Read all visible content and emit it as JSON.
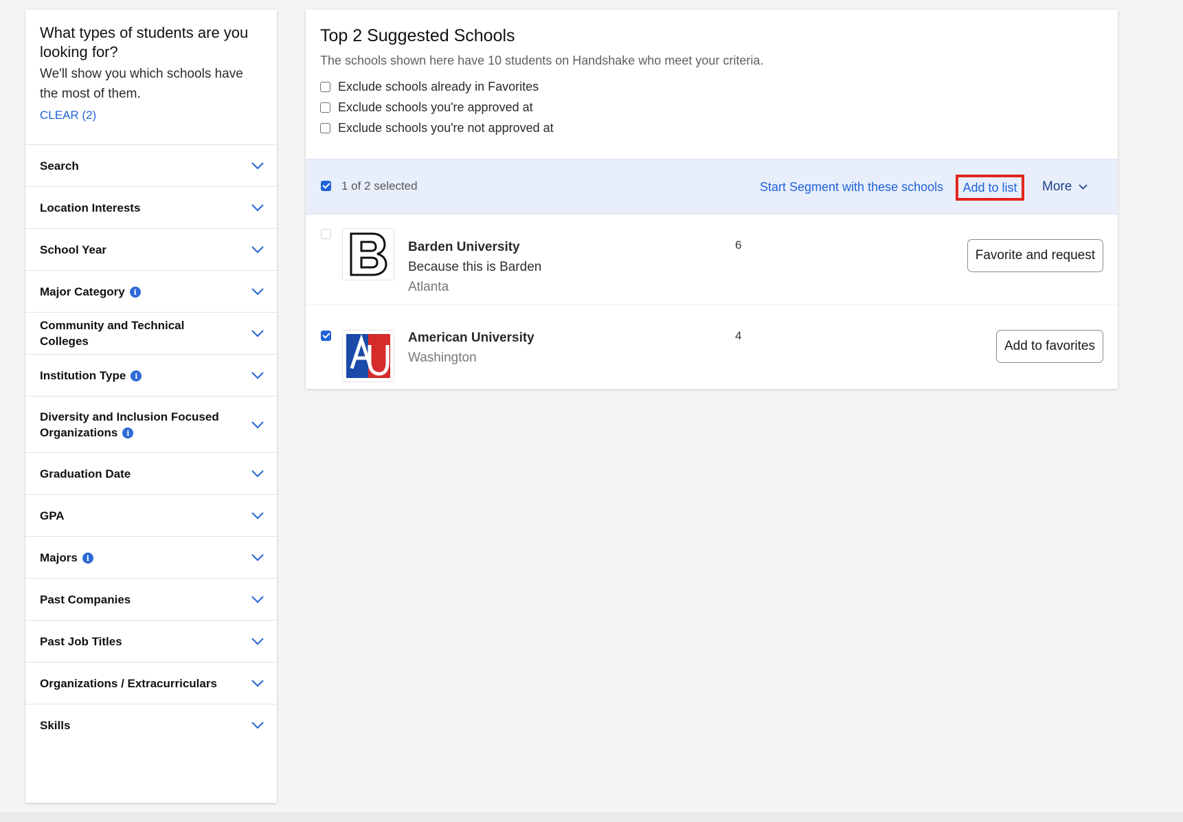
{
  "sidebar": {
    "title": "What types of students are you looking for?",
    "subtitle": "We'll show you which schools have the most of them.",
    "clear_label": "CLEAR (2)",
    "filters": [
      {
        "label": "Search",
        "info": false
      },
      {
        "label": "Location Interests",
        "info": false
      },
      {
        "label": "School Year",
        "info": false
      },
      {
        "label": "Major Category",
        "info": true
      },
      {
        "label": "Community and Technical Colleges",
        "info": false
      },
      {
        "label": "Institution Type",
        "info": true
      },
      {
        "label": "Diversity and Inclusion Focused Organizations",
        "info": true
      },
      {
        "label": "Graduation Date",
        "info": false
      },
      {
        "label": "GPA",
        "info": false
      },
      {
        "label": "Majors",
        "info": true
      },
      {
        "label": "Past Companies",
        "info": false
      },
      {
        "label": "Past Job Titles",
        "info": false
      },
      {
        "label": "Organizations / Extracurriculars",
        "info": false
      },
      {
        "label": "Skills",
        "info": false
      }
    ]
  },
  "main": {
    "title": "Top 2 Suggested Schools",
    "subtitle": "The schools shown here have 10 students on Handshake who meet your criteria.",
    "exclusions": [
      {
        "label": "Exclude schools already in Favorites",
        "checked": false
      },
      {
        "label": "Exclude schools you're approved at",
        "checked": false
      },
      {
        "label": "Exclude schools you're not approved at",
        "checked": false
      }
    ],
    "selection_bar": {
      "selected_text": "1 of 2 selected",
      "segment_link": "Start Segment with these schools",
      "add_to_list": "Add to list",
      "more": "More"
    },
    "schools": [
      {
        "name": "Barden University",
        "note": "Because this is Barden",
        "city": "Atlanta",
        "count": "6",
        "checked": false,
        "button": "Favorite and request",
        "logo": "barden-b-logo"
      },
      {
        "name": "American University",
        "note": "",
        "city": "Washington",
        "count": "4",
        "checked": true,
        "button": "Add to favorites",
        "logo": "american-university-au-logo"
      }
    ]
  },
  "colors": {
    "link_blue": "#1f62d8",
    "selection_bar_bg": "#e8effb",
    "highlight_red": "#e3261f",
    "au_blue": "#1c4aa8",
    "au_red": "#d52b2b"
  }
}
